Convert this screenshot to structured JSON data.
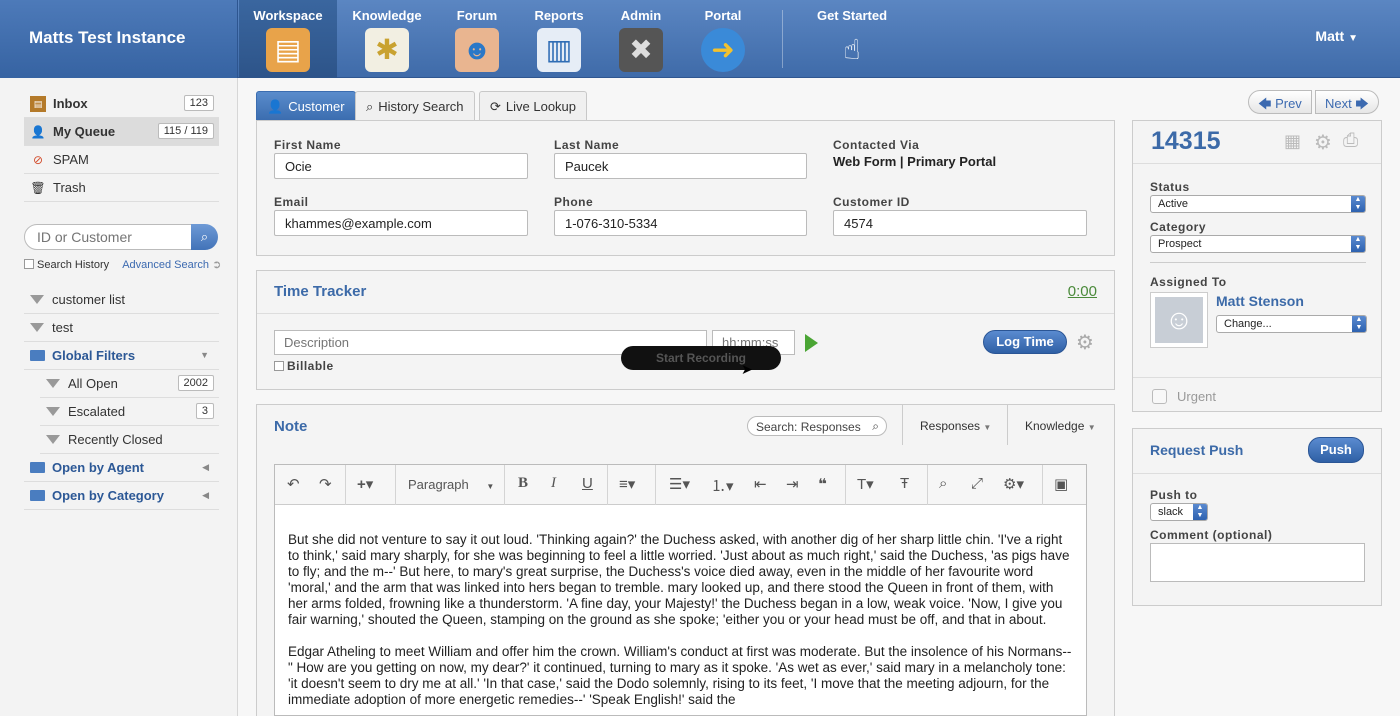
{
  "app": {
    "instance_title": "Matts Test Instance",
    "user": "Matt"
  },
  "nav": [
    {
      "label": "Workspace",
      "icon": "workspace-icon"
    },
    {
      "label": "Knowledge",
      "icon": "lightbulb-icon"
    },
    {
      "label": "Forum",
      "icon": "forum-icon"
    },
    {
      "label": "Reports",
      "icon": "reports-icon"
    },
    {
      "label": "Admin",
      "icon": "admin-tools-icon"
    },
    {
      "label": "Portal",
      "icon": "globe-icon"
    },
    {
      "label": "Get Started",
      "icon": "hand-pointer-icon"
    }
  ],
  "sidebar": {
    "inbox": {
      "label": "Inbox",
      "count": "123"
    },
    "my_queue": {
      "label": "My Queue",
      "count": "115 / 119"
    },
    "spam": {
      "label": "SPAM"
    },
    "trash": {
      "label": "Trash"
    },
    "search_placeholder": "ID or Customer",
    "search_history": "Search History",
    "advanced_search": "Advanced Search",
    "filters": {
      "customer_list": "customer list",
      "test": "test",
      "global_filters": "Global Filters",
      "all_open": {
        "label": "All Open",
        "count": "2002"
      },
      "escalated": {
        "label": "Escalated",
        "count": "3"
      },
      "recently_closed": "Recently Closed",
      "open_by_agent": "Open by Agent",
      "open_by_category": "Open by Category"
    }
  },
  "tabs": {
    "customer": "Customer",
    "history_search": "History Search",
    "live_lookup": "Live Lookup"
  },
  "pager": {
    "prev": "Prev",
    "next": "Next"
  },
  "customer": {
    "first_name_label": "First Name",
    "first_name": "Ocie",
    "last_name_label": "Last Name",
    "last_name": "Paucek",
    "contacted_via_label": "Contacted Via",
    "contacted_via": "Web Form | Primary Portal",
    "email_label": "Email",
    "email": "khammes@example.com",
    "phone_label": "Phone",
    "phone": "1-076-310-5334",
    "customer_id_label": "Customer ID",
    "customer_id": "4574"
  },
  "time_tracker": {
    "title": "Time Tracker",
    "elapsed": "0:00",
    "description_placeholder": "Description",
    "time_placeholder": "hh:mm:ss",
    "billable": "Billable",
    "log_time": "Log Time",
    "recording": "Start Recording"
  },
  "note": {
    "title": "Note",
    "search_placeholder": "Search: Responses",
    "responses": "Responses",
    "knowledge": "Knowledge",
    "paragraph_format": "Paragraph",
    "body": [
      "But she did not venture to say it out loud. 'Thinking again?' the Duchess asked, with another dig of her sharp little chin. 'I've a right to think,' said mary sharply, for she was beginning to feel a little worried. 'Just about as much right,' said the Duchess, 'as pigs have to fly; and the m--' But here, to mary's great surprise, the Duchess's voice died away, even in the middle of her favourite word 'moral,' and the arm that was linked into hers began to tremble. mary looked up, and there stood the Queen in front of them, with her arms folded, frowning like a thunderstorm. 'A fine day, your Majesty!' the Duchess began in a low, weak voice. 'Now, I give you fair warning,' shouted the Queen, stamping on the ground as she spoke; 'either you or your head must be off, and that in about.",
      "Edgar Atheling to meet William and offer him the crown. William's conduct at first was moderate. But the insolence of his Normans--\" How are you getting on now, my dear?' it continued, turning to mary as it spoke. 'As wet as ever,' said mary in a melancholy tone: 'it doesn't seem to dry me at all.' 'In that case,' said the Dodo solemnly, rising to its feet, 'I move that the meeting adjourn, for the immediate adoption of more energetic remedies--' 'Speak English!' said the"
    ]
  },
  "ticket": {
    "id": "14315",
    "status_label": "Status",
    "status": "Active",
    "category_label": "Category",
    "category": "Prospect",
    "assigned_label": "Assigned To",
    "assignee": "Matt Stenson",
    "change": "Change...",
    "urgent": "Urgent"
  },
  "push": {
    "title": "Request Push",
    "button": "Push",
    "push_to_label": "Push to",
    "push_to": "slack",
    "comment_label": "Comment (optional)"
  },
  "colors": {
    "accent": "#3c6aa8",
    "topbar": "#4a77b5"
  }
}
